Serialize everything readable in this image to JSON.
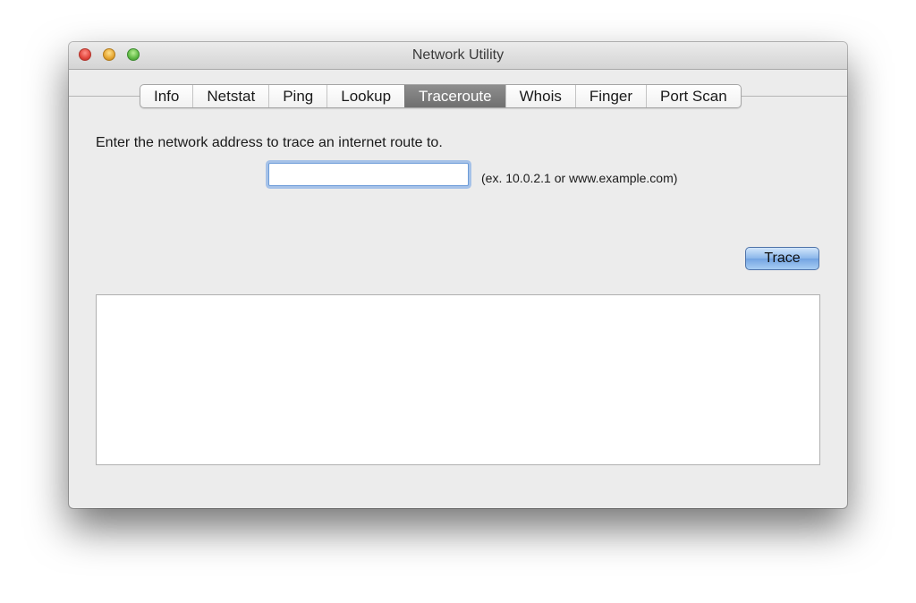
{
  "window": {
    "title": "Network Utility"
  },
  "tabs": [
    {
      "label": "Info",
      "selected": false
    },
    {
      "label": "Netstat",
      "selected": false
    },
    {
      "label": "Ping",
      "selected": false
    },
    {
      "label": "Lookup",
      "selected": false
    },
    {
      "label": "Traceroute",
      "selected": true
    },
    {
      "label": "Whois",
      "selected": false
    },
    {
      "label": "Finger",
      "selected": false
    },
    {
      "label": "Port Scan",
      "selected": false
    }
  ],
  "traceroute": {
    "instruction": "Enter the network address to trace an internet route to.",
    "address_value": "",
    "hint": "(ex. 10.0.2.1 or www.example.com)",
    "trace_button_label": "Trace",
    "output_text": ""
  },
  "colors": {
    "selected_tab": "#7d7d7d",
    "default_button": "#8ab6ea",
    "focus_ring": "#6ea0e6"
  }
}
